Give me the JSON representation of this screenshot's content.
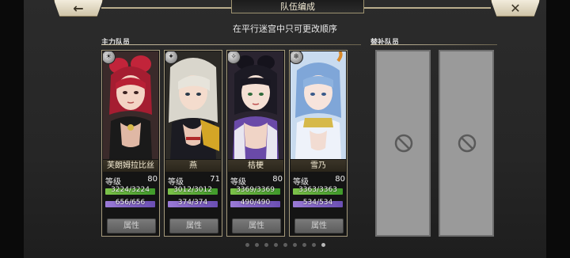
{
  "header": {
    "title": "队伍编成",
    "back_icon": "arrow-left-icon",
    "close_icon": "close-x-icon",
    "notice": "在平行迷宫中只可更改顺序"
  },
  "sections": {
    "main_label": "主力队员",
    "support_label": "替补队员"
  },
  "level_label": "等级",
  "attr_label": "属性",
  "cards": [
    {
      "name": "芙朗姆拉比丝",
      "level": "80",
      "hp": "3224/3224",
      "mp": "656/656",
      "element_icon": "element-icon"
    },
    {
      "name": "燕",
      "level": "71",
      "hp": "3012/3012",
      "mp": "374/374",
      "element_icon": "element-icon"
    },
    {
      "name": "桔梗",
      "level": "80",
      "hp": "3369/3369",
      "mp": "490/490",
      "element_icon": "element-icon"
    },
    {
      "name": "雪乃",
      "level": "80",
      "hp": "3363/3363",
      "mp": "534/534",
      "element_icon": "element-icon"
    }
  ],
  "support_slots": [
    {
      "state": "empty",
      "icon": "no-entry-icon"
    },
    {
      "state": "empty",
      "icon": "no-entry-icon"
    }
  ],
  "pager": {
    "page_count": 9,
    "current_page": 9
  },
  "colors": {
    "hp_bar": "#5aad38",
    "mp_bar": "#8466c8",
    "frame": "#a59a7c"
  }
}
